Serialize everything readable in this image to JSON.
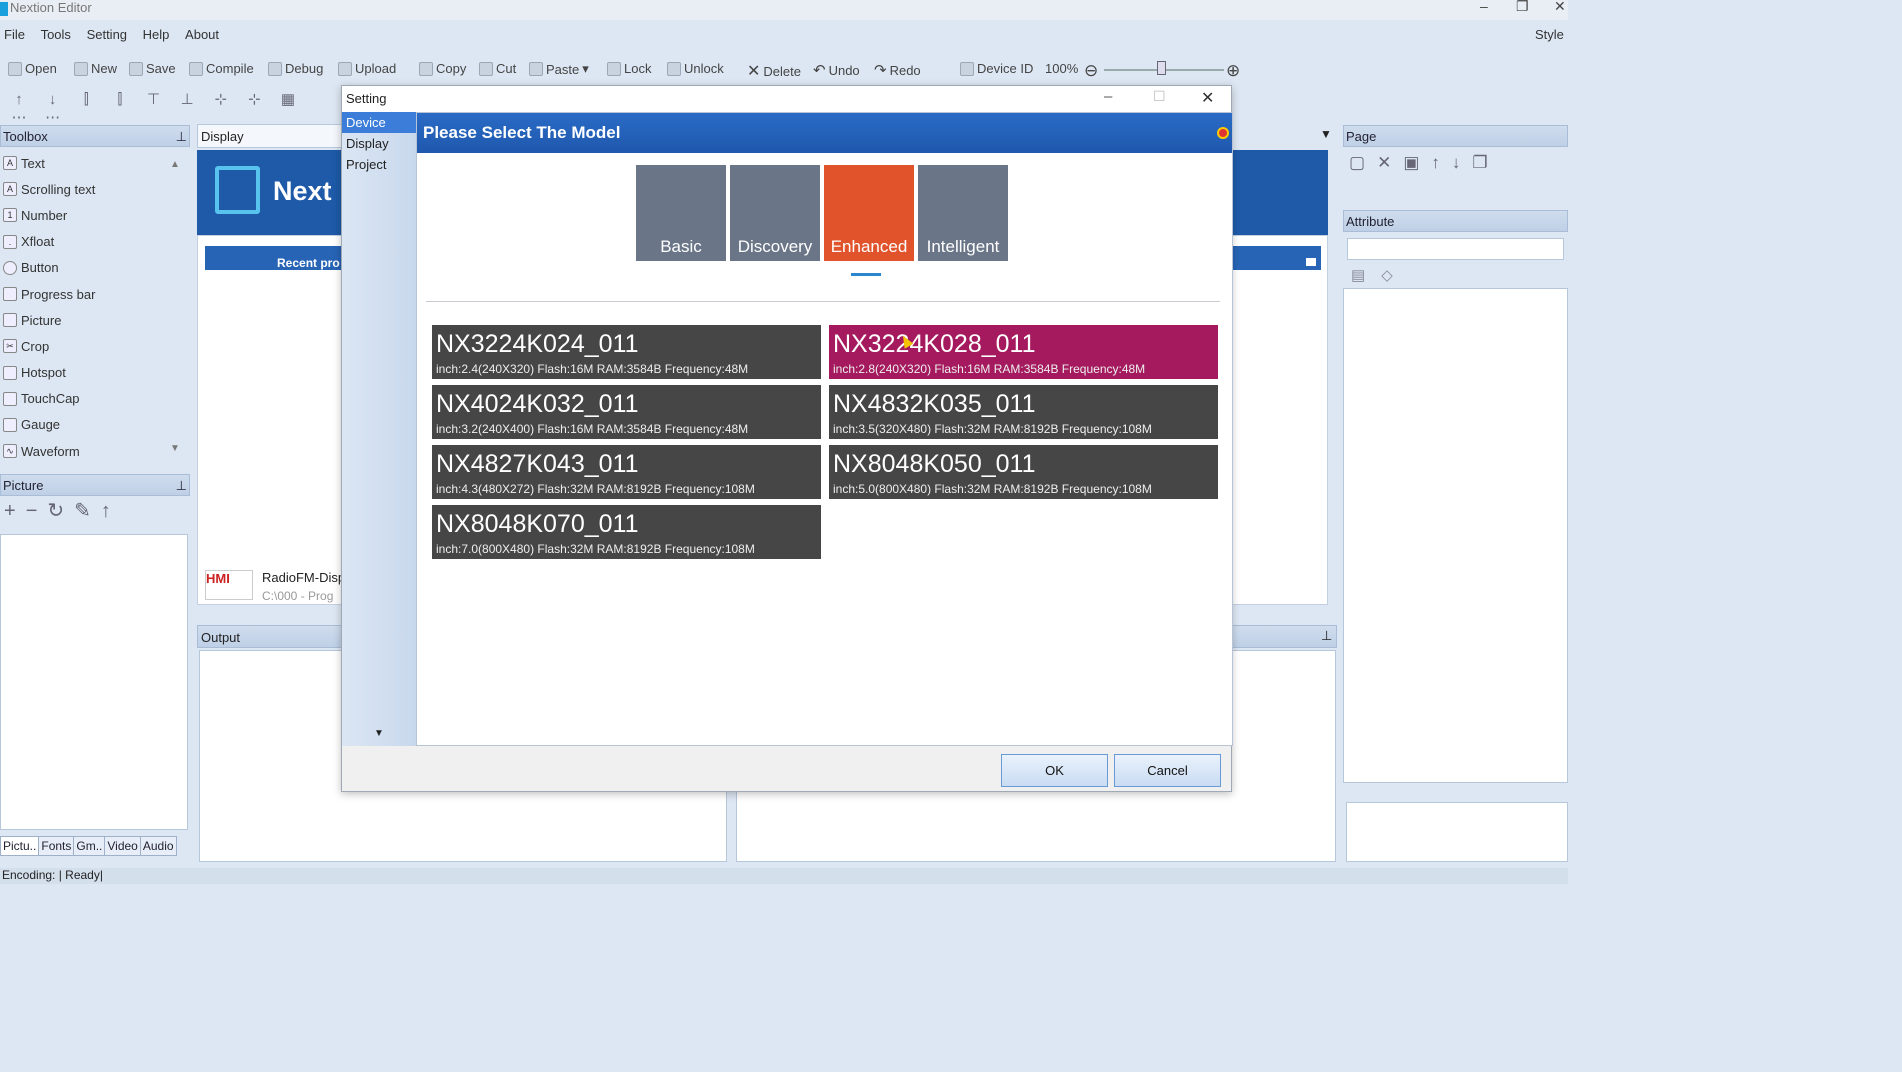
{
  "app": {
    "title": "Nextion Editor",
    "style_label": "Style"
  },
  "menu": [
    "File",
    "Tools",
    "Setting",
    "Help",
    "About"
  ],
  "toolbar": {
    "open": "Open",
    "new": "New",
    "save": "Save",
    "compile": "Compile",
    "debug": "Debug",
    "upload": "Upload",
    "copy": "Copy",
    "cut": "Cut",
    "paste": "Paste",
    "lock": "Lock",
    "unlock": "Unlock",
    "delete": "Delete",
    "undo": "Undo",
    "redo": "Redo",
    "device_id": "Device ID",
    "zoom": "100%"
  },
  "toolbox": {
    "title": "Toolbox",
    "items": [
      "Text",
      "Scrolling text",
      "Number",
      "Xfloat",
      "Button",
      "Progress bar",
      "Picture",
      "Crop",
      "Hotspot",
      "TouchCap",
      "Gauge",
      "Waveform"
    ]
  },
  "picture_panel": {
    "title": "Picture"
  },
  "bottom_tabs": [
    "Pictu..",
    "Fonts",
    "Gm..",
    "Video",
    "Audio"
  ],
  "display_tab": "Display",
  "splash": {
    "brand": "Next",
    "recent": "Recent pro",
    "hmi_tag": "HMI",
    "recent_file": "RadioFM-Disp",
    "recent_path": "C:\\000 - Prog"
  },
  "output": {
    "title": "Output"
  },
  "page_panel": {
    "title": "Page"
  },
  "attribute_panel": {
    "title": "Attribute"
  },
  "status": "Encoding: | Ready|",
  "dialog": {
    "title": "Setting",
    "nav": [
      "Device",
      "Display",
      "Project"
    ],
    "header": "Please Select The Model",
    "categories": [
      "Basic",
      "Discovery",
      "Enhanced",
      "Intelligent"
    ],
    "active_category": "Enhanced",
    "models": [
      {
        "name": "NX3224K024_011",
        "spec": "inch:2.4(240X320) Flash:16M RAM:3584B Frequency:48M"
      },
      {
        "name": "NX3224K028_011",
        "spec": "inch:2.8(240X320) Flash:16M RAM:3584B Frequency:48M"
      },
      {
        "name": "NX4024K032_011",
        "spec": "inch:3.2(240X400) Flash:16M RAM:3584B Frequency:48M"
      },
      {
        "name": "NX4832K035_011",
        "spec": "inch:3.5(320X480) Flash:32M RAM:8192B Frequency:108M"
      },
      {
        "name": "NX4827K043_011",
        "spec": "inch:4.3(480X272) Flash:32M RAM:8192B Frequency:108M"
      },
      {
        "name": "NX8048K050_011",
        "spec": "inch:5.0(800X480) Flash:32M RAM:8192B Frequency:108M"
      },
      {
        "name": "NX8048K070_011",
        "spec": "inch:7.0(800X480) Flash:32M RAM:8192B Frequency:108M"
      }
    ],
    "selected_model": "NX3224K028_011",
    "ok": "OK",
    "cancel": "Cancel"
  }
}
